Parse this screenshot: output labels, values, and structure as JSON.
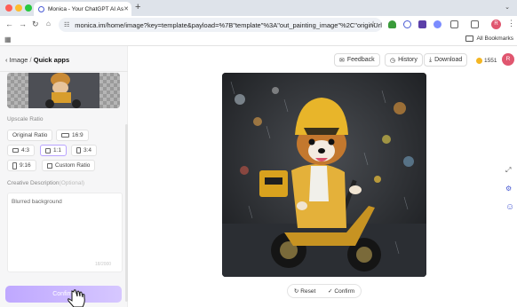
{
  "browser": {
    "tab_title": "Monica - Your ChatGPT AI As",
    "url": "monica.im/home/image?key=template&payload=%7B\"template\"%3A\"out_painting_image\"%2C\"originUrl...",
    "bookmarks_label": "All Bookmarks",
    "profile_initial": "R"
  },
  "sidebar": {
    "breadcrumb_root": "Image",
    "breadcrumb_sep": "/",
    "breadcrumb_current": "Quick apps",
    "upscale_label": "Upscale Ratio",
    "ratios": [
      "Original Ratio",
      "16:9",
      "4:3",
      "1:1",
      "3:4",
      "9:16",
      "Custom Ratio"
    ],
    "selected_ratio": "1:1",
    "description_label": "Creative Description",
    "description_optional": "(Optional)",
    "description_value": "Blurred background",
    "char_counter": "18/2000",
    "confirm_label": "Confirm"
  },
  "header": {
    "feedback": "Feedback",
    "history": "History",
    "download": "Download",
    "credits": "1551",
    "avatar_initial": "R"
  },
  "canvas": {
    "reset": "Reset",
    "confirm": "Confirm"
  },
  "colors": {
    "accent": "#b9a4ff",
    "avatar": "#e0566f",
    "coin": "#f4b623"
  }
}
